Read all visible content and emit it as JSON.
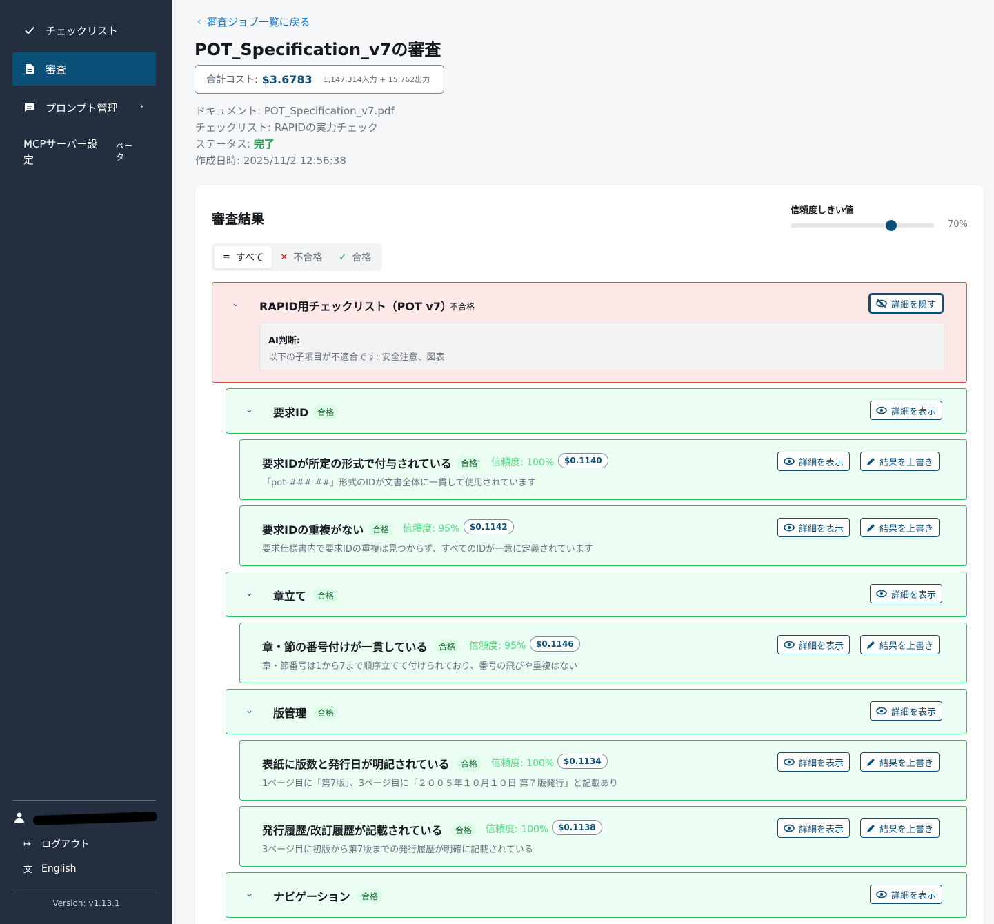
{
  "sidebar": {
    "items": [
      {
        "label": "チェックリスト",
        "icon": "check-icon"
      },
      {
        "label": "審査",
        "icon": "document-icon"
      },
      {
        "label": "プロンプト管理",
        "icon": "chat-icon"
      }
    ],
    "mcp_label": "MCPサーバー設定",
    "mcp_badge": "ベータ",
    "logout": "ログアウト",
    "language": "English",
    "version": "Version: v1.13.1"
  },
  "header": {
    "back": "審査ジョブ一覧に戻る",
    "title": "POT_Specification_v7の審査",
    "cost_label": "合計コスト:",
    "cost_value": "$3.6783",
    "cost_tokens": "1,147,314入力 + 15,762出力"
  },
  "meta": {
    "document": "ドキュメント: POT_Specification_v7.pdf",
    "checklist": "チェックリスト: RAPIDの実力チェック",
    "status_label": "ステータス:",
    "status_value": "完了",
    "created": "作成日時: 2025/11/2 12:56:38"
  },
  "results": {
    "title": "審査結果",
    "threshold_label": "信頼度しきい値",
    "threshold_value": "70%",
    "threshold_fraction": 0.7,
    "filters": [
      "すべて",
      "不合格",
      "合格"
    ],
    "buttons": {
      "hide": "詳細を隠す",
      "show": "詳細を表示",
      "override": "結果を上書き"
    },
    "root": {
      "title": "RAPID用チェックリスト（POT v7）",
      "badge": "不合格",
      "ai_label": "AI判断:",
      "ai_text": "以下の子項目が不適合です: 安全注意、図表"
    },
    "groups": [
      {
        "title": "要求ID",
        "badge": "合格"
      },
      {
        "title": "章立て",
        "badge": "合格"
      },
      {
        "title": "版管理",
        "badge": "合格"
      },
      {
        "title": "ナビゲーション",
        "badge": "合格"
      }
    ],
    "items": [
      {
        "title": "要求IDが所定の形式で付与されている",
        "badge": "合格",
        "confidence": "信頼度: 100%",
        "cost": "$0.1140",
        "desc": "「pot-###-##」形式のIDが文書全体に一貫して使用されています"
      },
      {
        "title": "要求IDの重複がない",
        "badge": "合格",
        "confidence": "信頼度: 95%",
        "cost": "$0.1142",
        "desc": "要求仕様書内で要求IDの重複は見つからず、すべてのIDが一意に定義されています"
      },
      {
        "title": "章・節の番号付けが一貫している",
        "badge": "合格",
        "confidence": "信頼度: 95%",
        "cost": "$0.1146",
        "desc": "章・節番号は1から7まで順序立てて付けられており、番号の飛びや重複はない"
      },
      {
        "title": "表紙に版数と発行日が明記されている",
        "badge": "合格",
        "confidence": "信頼度: 100%",
        "cost": "$0.1134",
        "desc": "1ページ目に「第7版」、3ページ目に「２００５年１０月１０日 第７版発行」と記載あり"
      },
      {
        "title": "発行履歴/改訂履歴が記載されている",
        "badge": "合格",
        "confidence": "信頼度: 100%",
        "cost": "$0.1138",
        "desc": "3ページ目に初版から第7版までの発行履歴が明確に記載されている"
      }
    ]
  }
}
